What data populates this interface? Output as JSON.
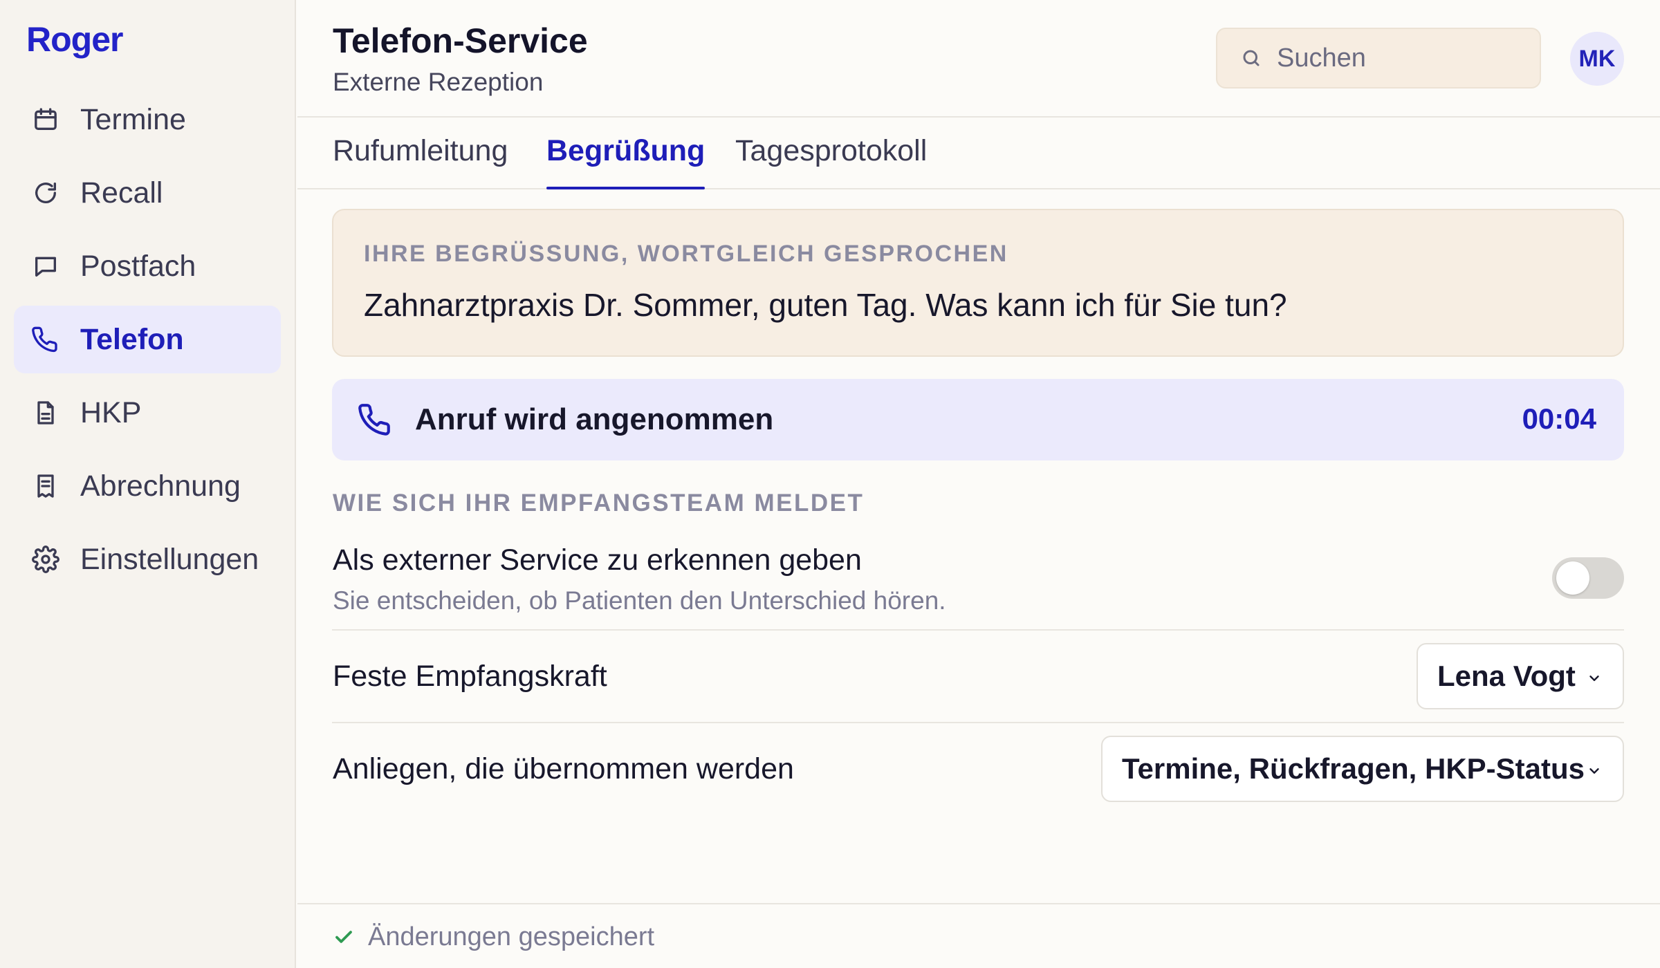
{
  "app": {
    "logo": "Roger"
  },
  "sidebar": {
    "items": [
      {
        "label": "Termine",
        "icon": "calendar-icon",
        "active": false
      },
      {
        "label": "Recall",
        "icon": "refresh-icon",
        "active": false
      },
      {
        "label": "Postfach",
        "icon": "message-icon",
        "active": false
      },
      {
        "label": "Telefon",
        "icon": "phone-icon",
        "active": true
      },
      {
        "label": "HKP",
        "icon": "document-icon",
        "active": false
      },
      {
        "label": "Abrechnung",
        "icon": "receipt-icon",
        "active": false
      },
      {
        "label": "Einstellungen",
        "icon": "gear-icon",
        "active": false
      }
    ]
  },
  "header": {
    "title": "Telefon-Service",
    "subtitle": "Externe Rezeption",
    "search_placeholder": "Suchen",
    "avatar_initials": "MK"
  },
  "tabs": [
    {
      "label": "Rufumleitung",
      "active": false
    },
    {
      "label": "Begrüßung",
      "active": true
    },
    {
      "label": "Tagesprotokoll",
      "active": false
    }
  ],
  "greeting": {
    "label": "IHRE BEGRÜSSUNG, WORTGLEICH GESPROCHEN",
    "text": "Zahnarztpraxis Dr. Sommer, guten Tag. Was kann ich für Sie tun?"
  },
  "call": {
    "status": "Anruf wird angenommen",
    "timer": "00:04"
  },
  "team_section": {
    "label": "WIE SICH IHR EMPFANGSTEAM MELDET",
    "external_toggle": {
      "title": "Als externer Service zu erkennen geben",
      "description": "Sie entscheiden, ob Patienten den Unterschied hören.",
      "enabled": false
    },
    "receptionist": {
      "label": "Feste Empfangskraft",
      "value": "Lena Vogt"
    },
    "concerns": {
      "label": "Anliegen, die übernommen werden",
      "value": "Termine, Rückfragen, HKP-Status"
    }
  },
  "footer": {
    "status": "Änderungen gespeichert",
    "icon": "check-icon"
  },
  "colors": {
    "accent": "#1e1eb8",
    "sidebar_bg": "#f6f3ee",
    "greeting_bg": "#f7eee3",
    "call_bg": "#ebeafc",
    "success": "#2e9a52"
  }
}
